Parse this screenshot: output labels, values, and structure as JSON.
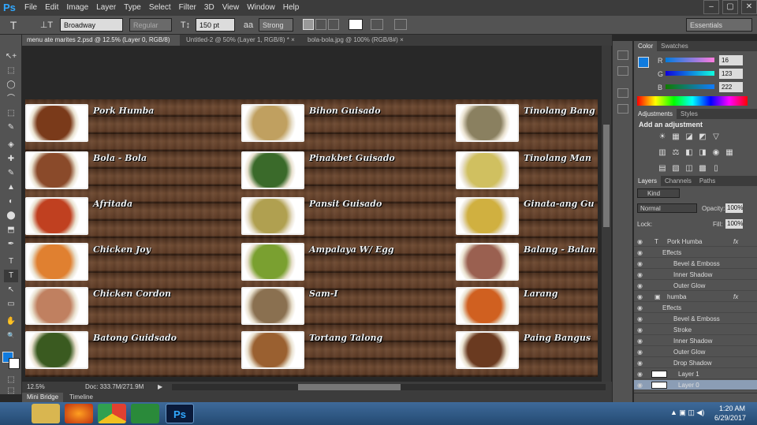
{
  "app": {
    "logo": "Ps"
  },
  "menubar": {
    "items": [
      "File",
      "Edit",
      "Image",
      "Layer",
      "Type",
      "Select",
      "Filter",
      "3D",
      "View",
      "Window",
      "Help"
    ],
    "window_controls": [
      "–",
      "▢",
      "✕"
    ]
  },
  "options": {
    "tool_icon": "T",
    "orient_icon": "⊥T",
    "font_family": "Broadway",
    "font_style": "Regular",
    "size_icon": "T↕",
    "font_size": "150 pt",
    "aa_icon": "aa",
    "antialias": "Strong",
    "workspace": "Essentials"
  },
  "tabs": [
    {
      "label": "menu ate marites 2.psd @ 12.5% (Layer 0, RGB/8)",
      "close": "×"
    },
    {
      "label": "Untitled-2 @ 50% (Layer 1, RGB/8) *",
      "close": "×"
    },
    {
      "label": "bola-bola.jpg @ 100% (RGB/8#)",
      "close": "×"
    }
  ],
  "tools": [
    "↖+",
    "⬚",
    "◯",
    "⌒",
    "⬚",
    "✎",
    "◈",
    "✚",
    "✎",
    "▲",
    "◐",
    "⬤",
    "⬒",
    "✒",
    "T",
    "↖",
    "▭",
    "✋",
    "🔍",
    "⬚",
    "⬚"
  ],
  "canvas": {
    "colors": {
      "wood": "#5e3c27",
      "frame": "#f2f2f2"
    },
    "columns": [
      {
        "dishes": [
          "Pork Humba",
          "Bola - Bola",
          "Afritada",
          "Chicken Joy",
          "Chicken Cordon",
          "Batong Guidsado"
        ],
        "colors": [
          "#7a3a1a",
          "#8a4a2a",
          "#c04020",
          "#e08030",
          "#c08060",
          "#3a5a20"
        ]
      },
      {
        "dishes": [
          "Bihon Guisado",
          "Pinakbet Guisado",
          "Pansit Guisado",
          "Ampalaya W/ Egg",
          "Sam-I",
          "Tortang Talong"
        ],
        "colors": [
          "#c0a060",
          "#3a6a2a",
          "#b0a050",
          "#7aa030",
          "#8a7050",
          "#9a6030"
        ]
      },
      {
        "dishes": [
          "Tinolang Bang",
          "Tinolang Man",
          "Ginata-ang Gu",
          "Balang - Balan",
          "Larang",
          "Paing Bangus"
        ],
        "colors": [
          "#8a8060",
          "#d0c060",
          "#d0b040",
          "#9a6050",
          "#d06020",
          "#6a3a20"
        ]
      }
    ]
  },
  "status": {
    "zoom": "12.5%",
    "doc": "Doc: 333.7M/271.9M",
    "arrow": "▶"
  },
  "bottom_tabs": [
    "Mini Bridge",
    "Timeline"
  ],
  "color_panel": {
    "tabs": [
      "Color",
      "Swatches"
    ],
    "labels": [
      "R",
      "G",
      "B"
    ],
    "r": "16",
    "g": "123",
    "b": "222",
    "fg_color": "#107bde"
  },
  "adjustments_panel": {
    "tabs": [
      "Adjustments",
      "Styles"
    ],
    "title": "Add an adjustment",
    "icons": [
      "☀",
      "▦",
      "◪",
      "◩",
      "▽",
      "▥",
      "⚖",
      "◧",
      "◨",
      "◉",
      "▦",
      "▤",
      "▧",
      "◫",
      "▩",
      "▯"
    ]
  },
  "layers_panel": {
    "tabs": [
      "Layers",
      "Channels",
      "Paths"
    ],
    "kind": "Kind",
    "blend_mode": "Normal",
    "opacity_label": "Opacity:",
    "opacity": "100%",
    "lock_label": "Lock:",
    "fill_label": "Fill:",
    "fill": "100%",
    "rows": [
      {
        "name": "Pork Humba",
        "kind": "T",
        "indent": 0,
        "fx": "fx"
      },
      {
        "name": "Effects",
        "indent": 1
      },
      {
        "name": "Bevel & Emboss",
        "indent": 2
      },
      {
        "name": "Inner Shadow",
        "indent": 2
      },
      {
        "name": "Outer Glow",
        "indent": 2
      },
      {
        "name": "humba",
        "kind": "▣",
        "indent": 0,
        "fx": "fx"
      },
      {
        "name": "Effects",
        "indent": 1
      },
      {
        "name": "Bevel & Emboss",
        "indent": 2
      },
      {
        "name": "Stroke",
        "indent": 2
      },
      {
        "name": "Inner Shadow",
        "indent": 2
      },
      {
        "name": "Outer Glow",
        "indent": 2
      },
      {
        "name": "Drop Shadow",
        "indent": 2
      },
      {
        "name": "Layer 1",
        "indent": 0
      },
      {
        "name": "Layer 0",
        "indent": 0
      }
    ]
  },
  "taskbar": {
    "apps": [
      "",
      "",
      "",
      "",
      ""
    ],
    "ps_label": "Ps",
    "time": "1:20 AM",
    "date": "6/29/2017"
  }
}
